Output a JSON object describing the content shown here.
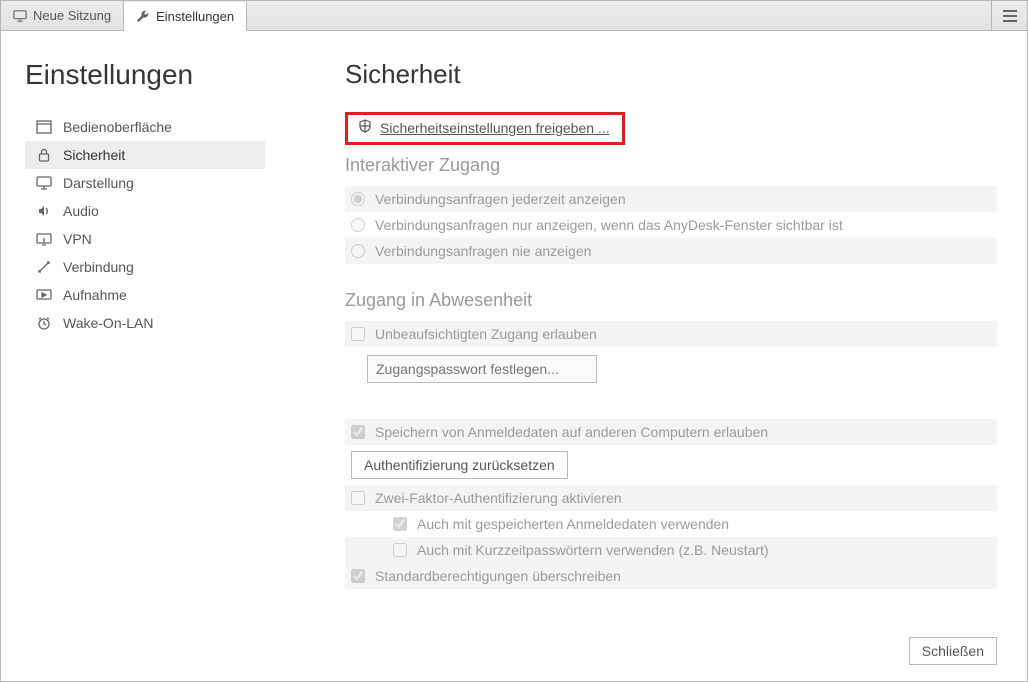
{
  "tabs": {
    "new_session": "Neue Sitzung",
    "settings": "Einstellungen"
  },
  "settings_title": "Einstellungen",
  "sidebar": {
    "items": [
      {
        "label": "Bedienoberfläche"
      },
      {
        "label": "Sicherheit"
      },
      {
        "label": "Darstellung"
      },
      {
        "label": "Audio"
      },
      {
        "label": "VPN"
      },
      {
        "label": "Verbindung"
      },
      {
        "label": "Aufnahme"
      },
      {
        "label": "Wake-On-LAN"
      }
    ]
  },
  "page": {
    "title": "Sicherheit",
    "unlock_label": "Sicherheitseinstellungen freigeben ...",
    "section_interactive": "Interaktiver Zugang",
    "radio_always": "Verbindungsanfragen jederzeit anzeigen",
    "radio_visible": "Verbindungsanfragen nur anzeigen, wenn das AnyDesk-Fenster sichtbar ist",
    "radio_never": "Verbindungsanfragen nie anzeigen",
    "section_absent": "Zugang in Abwesenheit",
    "cb_unattended": "Unbeaufsichtigten Zugang erlauben",
    "password_placeholder": "Zugangspasswort festlegen...",
    "cb_store_creds": "Speichern von Anmeldedaten auf anderen Computern erlauben",
    "btn_reset_auth": "Authentifizierung zurücksetzen",
    "cb_2fa": "Zwei-Faktor-Authentifizierung aktivieren",
    "cb_2fa_saved": "Auch mit gespeicherten Anmeldedaten verwenden",
    "cb_2fa_shortpw": "Auch mit Kurzzeitpasswörtern verwenden (z.B. Neustart)",
    "cb_override_perms": "Standardberechtigungen überschreiben",
    "btn_close": "Schließen"
  }
}
